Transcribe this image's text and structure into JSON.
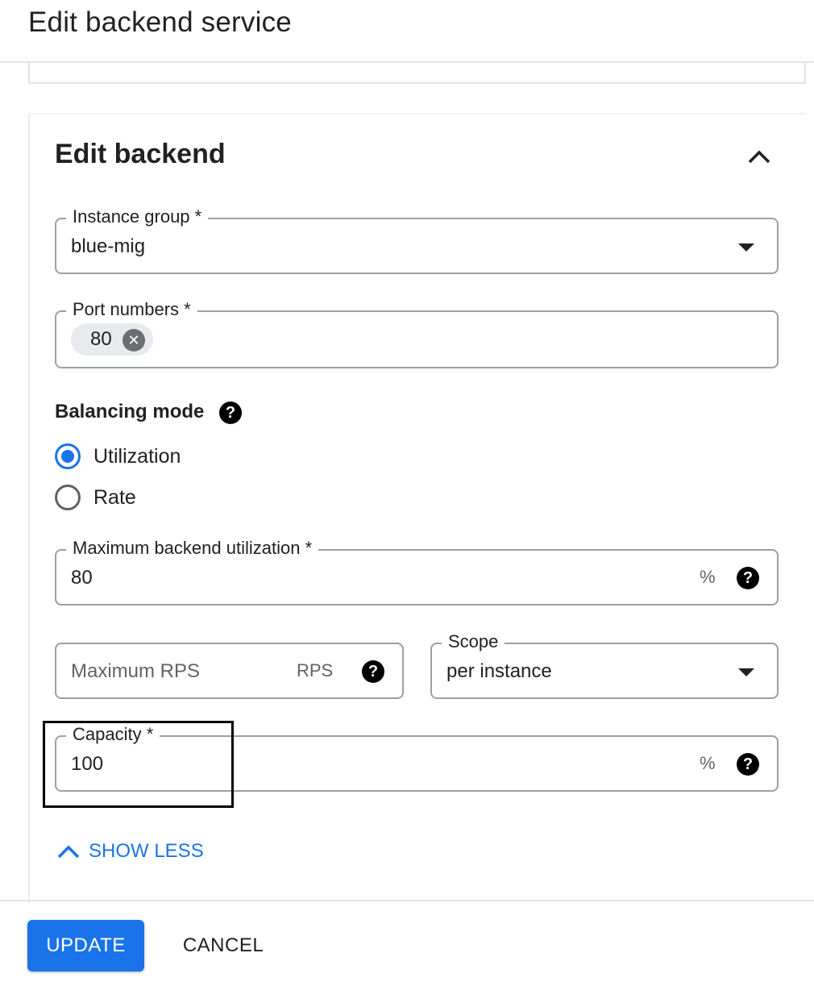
{
  "header": {
    "title": "Edit backend service"
  },
  "backend_card": {
    "title": "Edit backend",
    "instance_group": {
      "label": "Instance group *",
      "value": "blue-mig"
    },
    "port_numbers": {
      "label": "Port numbers *",
      "chips": [
        "80"
      ]
    },
    "balancing_mode": {
      "label": "Balancing mode",
      "options": [
        {
          "label": "Utilization",
          "checked": true
        },
        {
          "label": "Rate",
          "checked": false
        }
      ]
    },
    "max_utilization": {
      "label": "Maximum backend utilization *",
      "value": "80",
      "suffix": "%"
    },
    "max_rps": {
      "placeholder": "Maximum RPS",
      "suffix": "RPS"
    },
    "scope": {
      "label": "Scope",
      "value": "per instance"
    },
    "capacity": {
      "label": "Capacity *",
      "value": "100",
      "suffix": "%"
    },
    "show_less": "SHOW LESS"
  },
  "footer": {
    "update_label": "UPDATE",
    "cancel_label": "CANCEL"
  },
  "icons": {
    "help": "help-circle-icon",
    "collapse": "chevron-up-icon",
    "dropdown": "arrow-drop-down-icon",
    "chip_remove": "cancel-circle-icon"
  },
  "colors": {
    "accent": "#1a73e8",
    "outline": "#9aa0a6",
    "text": "#202124",
    "muted": "#5f6368"
  }
}
